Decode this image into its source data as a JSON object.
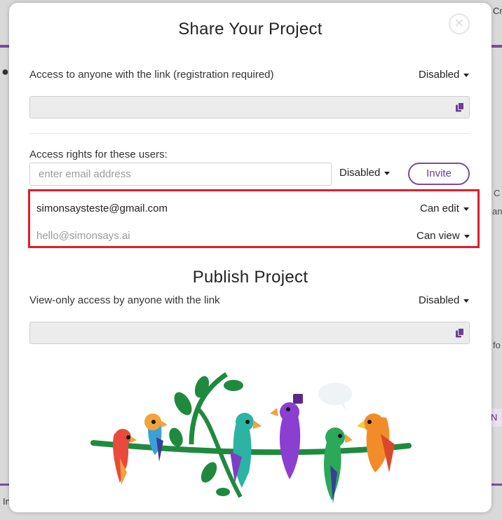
{
  "background": {
    "frag_top_right": "Cr",
    "frag_left_icon": "person-icon",
    "frag_r1": "C",
    "frag_r2": "an",
    "frag_r3": "fo",
    "frag_r4": "N",
    "frag_bottom_left": "In"
  },
  "modal": {
    "title": "Share Your Project",
    "close_label": "×",
    "link_access": {
      "label": "Access to anyone with the link (registration required)",
      "status": "Disabled",
      "link_value": ""
    },
    "users": {
      "label": "Access rights for these users:",
      "email_placeholder": "enter email address",
      "invite_permission": "Disabled",
      "invite_button": "Invite",
      "list": [
        {
          "email": "simonsaysteste@gmail.com",
          "permission": "Can edit"
        },
        {
          "email": "hello@simonsays.ai",
          "permission": "Can view"
        }
      ]
    },
    "publish": {
      "title": "Publish Project",
      "label": "View-only access by anyone with the link",
      "status": "Disabled",
      "link_value": ""
    }
  },
  "colors": {
    "accent": "#7a4ca0",
    "highlight_border": "#e01e2b",
    "field_bg": "#ececec"
  }
}
